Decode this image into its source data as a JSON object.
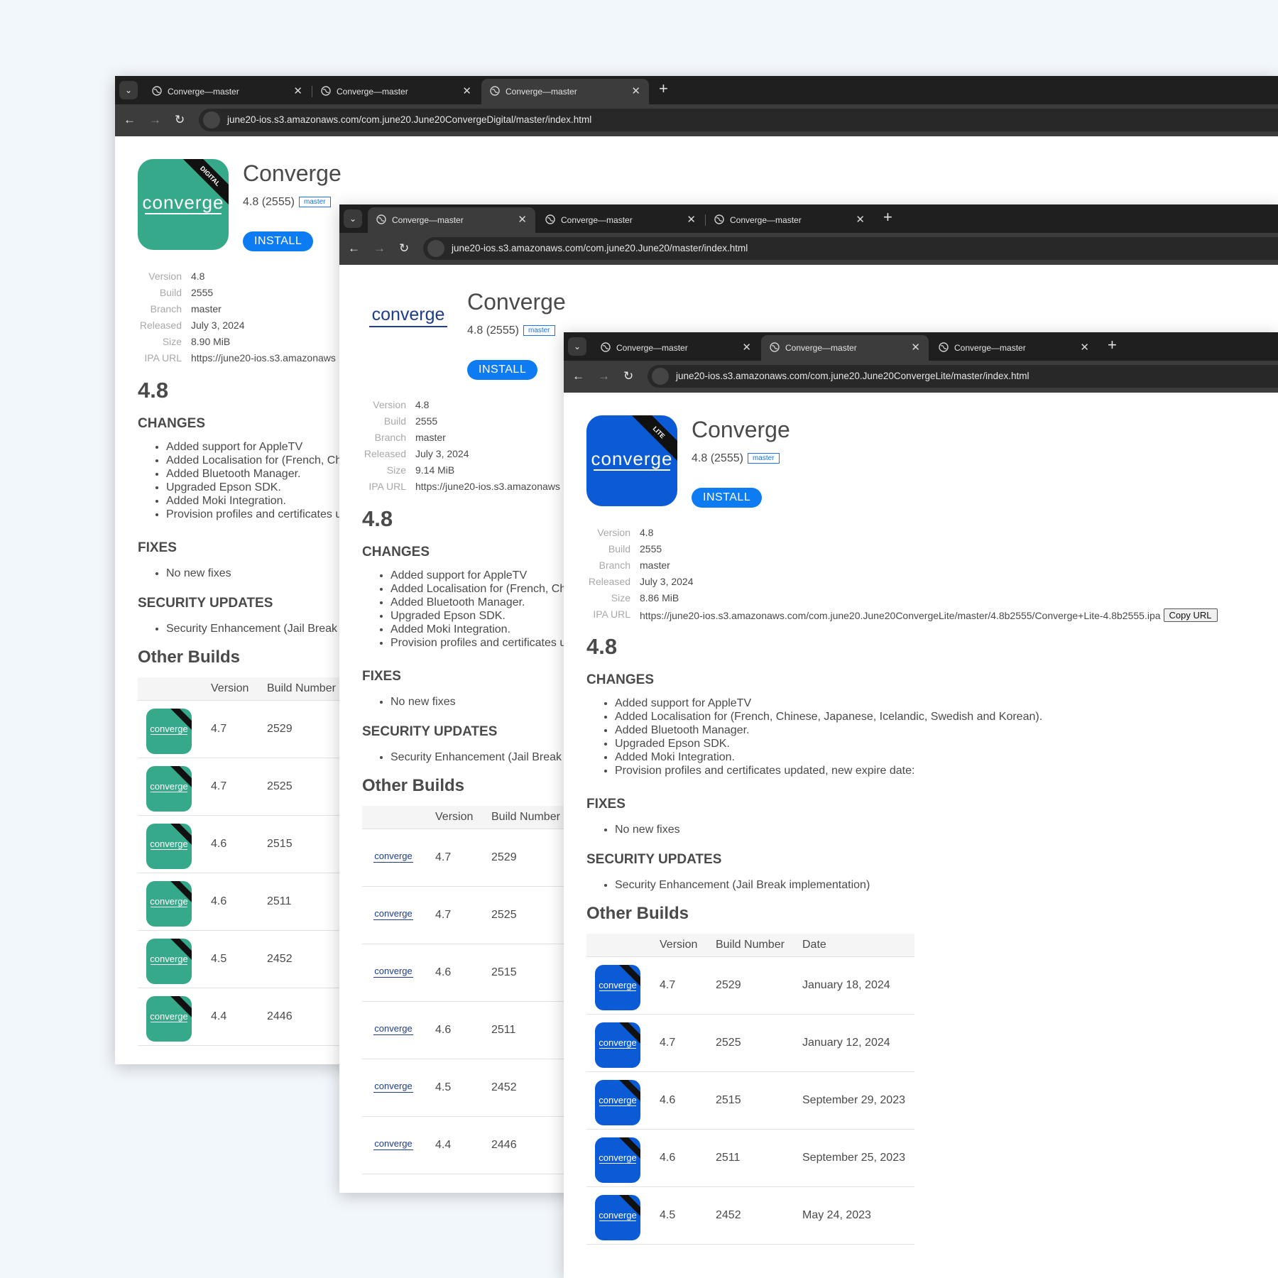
{
  "colors": {
    "digital": "#35a98a",
    "lite": "#0b5bd6",
    "accent": "#0d7cf2"
  },
  "windows": [
    {
      "tabs": [
        {
          "title": "Converge—master",
          "active": false
        },
        {
          "title": "Converge—master",
          "active": false
        },
        {
          "title": "Converge—master",
          "active": true
        }
      ],
      "url": "june20-ios.s3.amazonaws.com/com.june20.June20ConvergeDigital/master/index.html",
      "app": {
        "icon_variant": "digital",
        "logo_text": "converge",
        "ribbon": "DIGITAL",
        "title": "Converge",
        "version_build": "4.8 (2555)",
        "branch_badge": "master",
        "install_label": "INSTALL"
      },
      "meta": [
        {
          "key": "Version",
          "value": "4.8"
        },
        {
          "key": "Build",
          "value": "2555"
        },
        {
          "key": "Branch",
          "value": "master"
        },
        {
          "key": "Released",
          "value": "July 3, 2024"
        },
        {
          "key": "Size",
          "value": "8.90 MiB"
        },
        {
          "key": "IPA URL",
          "value": "https://june20-ios.s3.amazonaws"
        }
      ],
      "big_version": "4.8",
      "changes_heading": "CHANGES",
      "changes": [
        "Added support for AppleTV",
        "Added Localisation for (French, Ch",
        "Added Bluetooth Manager.",
        "Upgraded Epson SDK.",
        "Added Moki Integration.",
        "Provision profiles and certificates u"
      ],
      "fixes_heading": "FIXES",
      "fixes": [
        "No new fixes"
      ],
      "security_heading": "SECURITY UPDATES",
      "security": [
        "Security Enhancement (Jail Break"
      ],
      "other_builds_heading": "Other Builds",
      "builds_header": {
        "version": "Version",
        "build": "Build Number"
      },
      "builds": [
        {
          "version": "4.7",
          "build": "2529"
        },
        {
          "version": "4.7",
          "build": "2525"
        },
        {
          "version": "4.6",
          "build": "2515"
        },
        {
          "version": "4.6",
          "build": "2511"
        },
        {
          "version": "4.5",
          "build": "2452"
        },
        {
          "version": "4.4",
          "build": "2446"
        }
      ]
    },
    {
      "tabs": [
        {
          "title": "Converge—master",
          "active": true
        },
        {
          "title": "Converge—master",
          "active": false
        },
        {
          "title": "Converge—master",
          "active": false
        }
      ],
      "url": "june20-ios.s3.amazonaws.com/com.june20.June20/master/index.html",
      "app": {
        "icon_variant": "plain",
        "logo_text": "converge",
        "title": "Converge",
        "version_build": "4.8 (2555)",
        "branch_badge": "master",
        "install_label": "INSTALL"
      },
      "meta": [
        {
          "key": "Version",
          "value": "4.8"
        },
        {
          "key": "Build",
          "value": "2555"
        },
        {
          "key": "Branch",
          "value": "master"
        },
        {
          "key": "Released",
          "value": "July 3, 2024"
        },
        {
          "key": "Size",
          "value": "9.14 MiB"
        },
        {
          "key": "IPA URL",
          "value": "https://june20-ios.s3.amazonaws"
        }
      ],
      "big_version": "4.8",
      "changes_heading": "CHANGES",
      "changes": [
        "Added support for AppleTV",
        "Added Localisation for (French, Ch",
        "Added Bluetooth Manager.",
        "Upgraded Epson SDK.",
        "Added Moki Integration.",
        "Provision profiles and certificates u"
      ],
      "fixes_heading": "FIXES",
      "fixes": [
        "No new fixes"
      ],
      "security_heading": "SECURITY UPDATES",
      "security": [
        "Security Enhancement (Jail Break"
      ],
      "other_builds_heading": "Other Builds",
      "builds_header": {
        "version": "Version",
        "build": "Build Number"
      },
      "builds": [
        {
          "version": "4.7",
          "build": "2529"
        },
        {
          "version": "4.7",
          "build": "2525"
        },
        {
          "version": "4.6",
          "build": "2515"
        },
        {
          "version": "4.6",
          "build": "2511"
        },
        {
          "version": "4.5",
          "build": "2452"
        },
        {
          "version": "4.4",
          "build": "2446"
        }
      ]
    },
    {
      "tabs": [
        {
          "title": "Converge—master",
          "active": false
        },
        {
          "title": "Converge—master",
          "active": true
        },
        {
          "title": "Converge—master",
          "active": false
        }
      ],
      "url": "june20-ios.s3.amazonaws.com/com.june20.June20ConvergeLite/master/index.html",
      "app": {
        "icon_variant": "lite",
        "logo_text": "converge",
        "ribbon": "LITE",
        "title": "Converge",
        "version_build": "4.8 (2555)",
        "branch_badge": "master",
        "install_label": "INSTALL"
      },
      "meta": [
        {
          "key": "Version",
          "value": "4.8"
        },
        {
          "key": "Build",
          "value": "2555"
        },
        {
          "key": "Branch",
          "value": "master"
        },
        {
          "key": "Released",
          "value": "July 3, 2024"
        },
        {
          "key": "Size",
          "value": "8.86 MiB"
        },
        {
          "key": "IPA URL",
          "value": "https://june20-ios.s3.amazonaws.com/com.june20.June20ConvergeLite/master/4.8b2555/Converge+Lite-4.8b2555.ipa",
          "copy_label": "Copy URL"
        }
      ],
      "big_version": "4.8",
      "changes_heading": "CHANGES",
      "changes": [
        "Added support for AppleTV",
        "Added Localisation for (French, Chinese, Japanese, Icelandic, Swedish and Korean).",
        "Added Bluetooth Manager.",
        "Upgraded Epson SDK.",
        "Added Moki Integration.",
        "Provision profiles and certificates updated, new expire date:"
      ],
      "fixes_heading": "FIXES",
      "fixes": [
        "No new fixes"
      ],
      "security_heading": "SECURITY UPDATES",
      "security": [
        "Security Enhancement (Jail Break implementation)"
      ],
      "other_builds_heading": "Other Builds",
      "builds_header": {
        "version": "Version",
        "build": "Build Number",
        "date": "Date"
      },
      "builds": [
        {
          "version": "4.7",
          "build": "2529",
          "date": "January 18, 2024"
        },
        {
          "version": "4.7",
          "build": "2525",
          "date": "January 12, 2024"
        },
        {
          "version": "4.6",
          "build": "2515",
          "date": "September 29, 2023"
        },
        {
          "version": "4.6",
          "build": "2511",
          "date": "September 25, 2023"
        },
        {
          "version": "4.5",
          "build": "2452",
          "date": "May 24, 2023"
        }
      ]
    }
  ]
}
